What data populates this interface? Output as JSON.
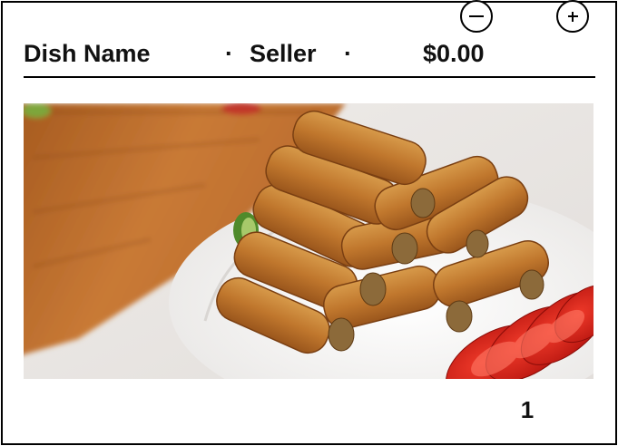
{
  "header": {
    "dish_name": "Dish Name",
    "separator": "·",
    "seller": "Seller",
    "price": "$0.00"
  },
  "image": {
    "subject": "spring rolls on plate with sliced tomatoes"
  },
  "quantity": {
    "value": "1",
    "decrement_icon": "minus-circle-icon",
    "increment_icon": "plus-circle-icon"
  },
  "colors": {
    "border": "#000000",
    "text": "#111111",
    "background": "#ffffff"
  }
}
